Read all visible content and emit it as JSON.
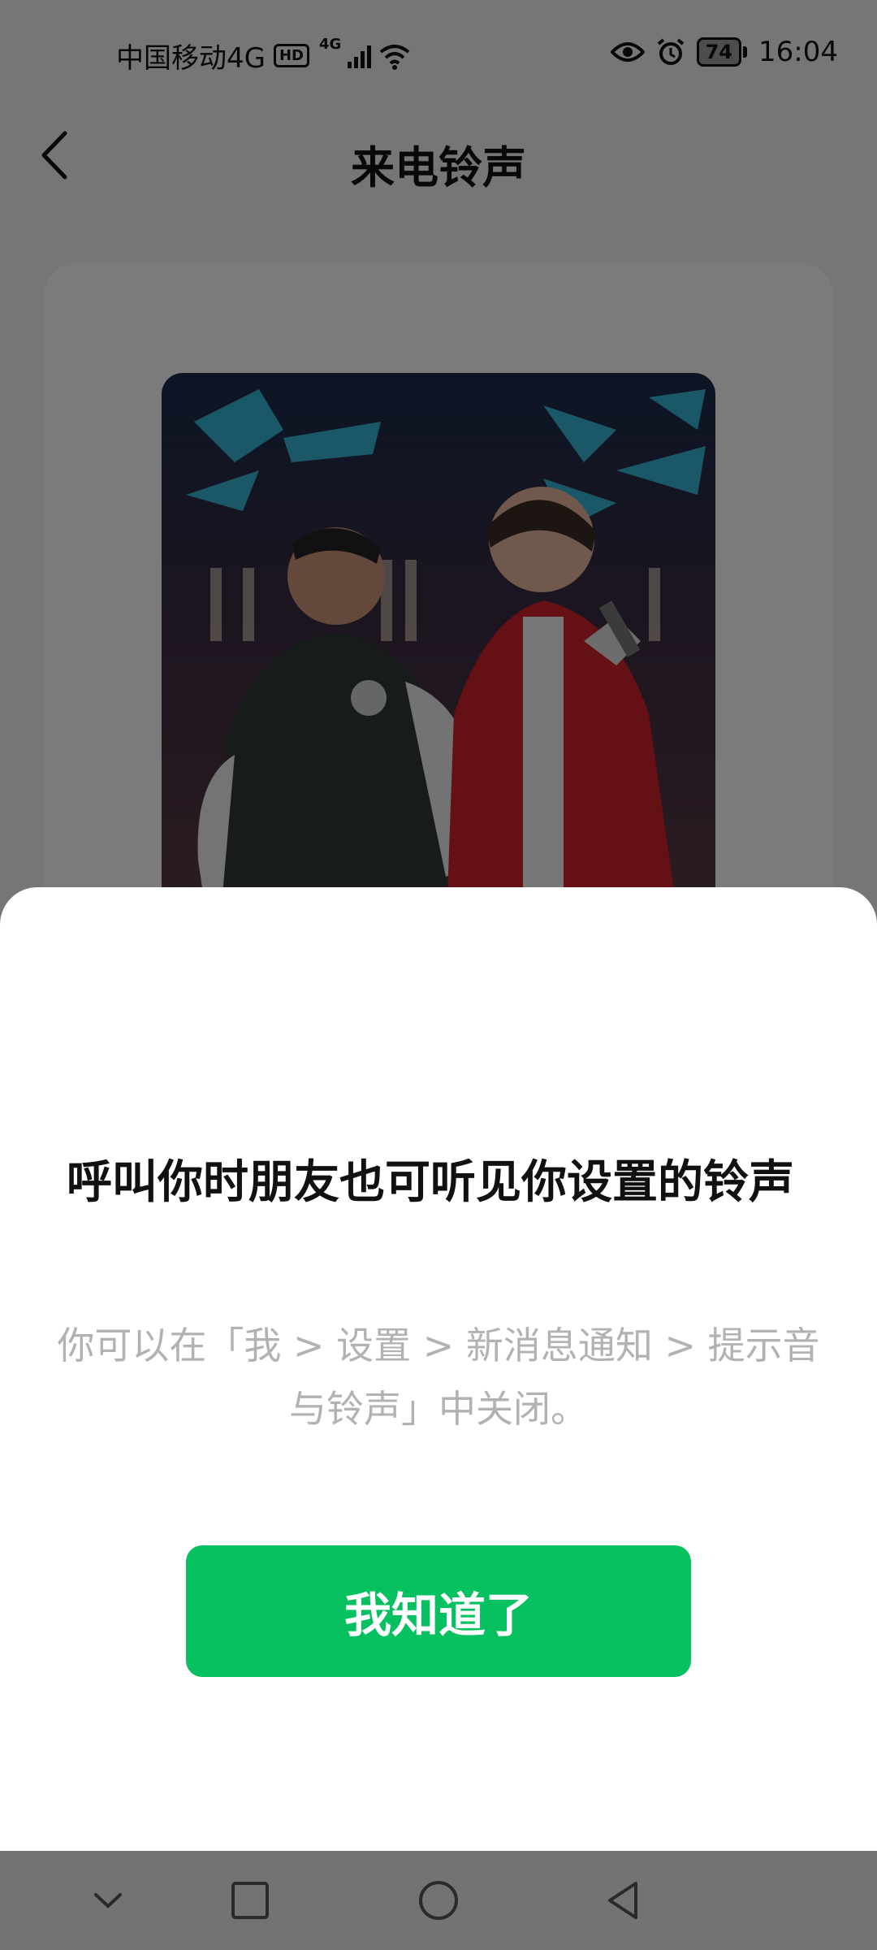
{
  "status_bar": {
    "carrier": "中国移动4G",
    "hd_badge": "HD",
    "network_type": "4G",
    "battery_level": "74",
    "time": "16:04",
    "icons": [
      "signal-icon",
      "wifi-icon",
      "eye-icon",
      "alarm-icon",
      "battery-icon"
    ]
  },
  "header": {
    "title": "来电铃声",
    "back_icon": "chevron-left-icon"
  },
  "sheet": {
    "title": "呼叫你时朋友也可听见你设置的铃声",
    "description": "你可以在「我 > 设置 > 新消息通知 > 提示音与铃声」中关闭。",
    "confirm_label": "我知道了"
  },
  "system_nav": {
    "icons": [
      "chevron-down-icon",
      "square-icon",
      "circle-icon",
      "triangle-back-icon"
    ]
  },
  "colors": {
    "accent": "#07c160",
    "overlay": "rgba(0,0,0,0.5)",
    "description_text": "#b2b2b2"
  }
}
